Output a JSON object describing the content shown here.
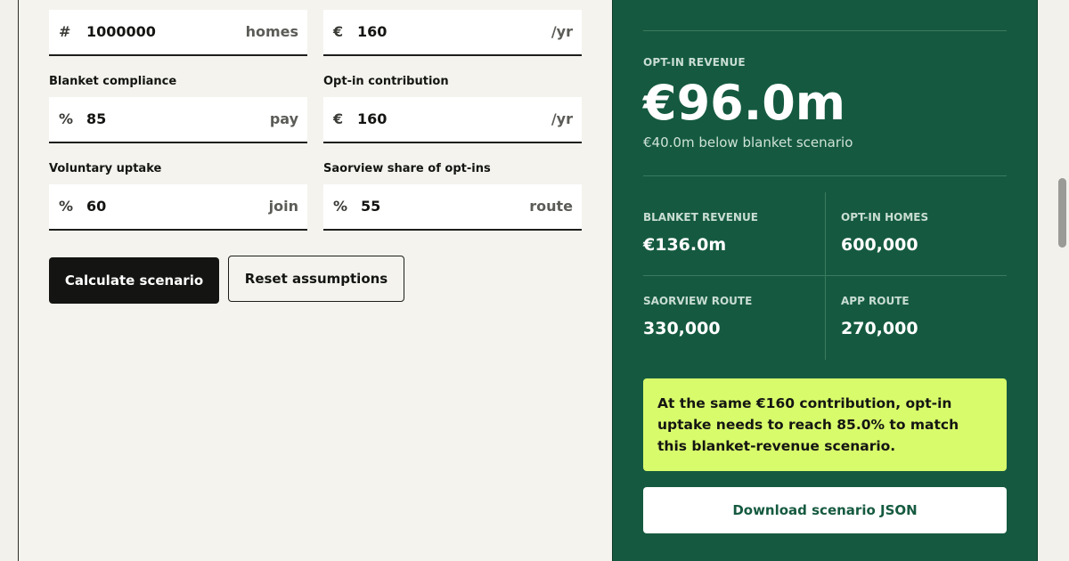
{
  "inputs": {
    "homes": {
      "label": "",
      "prefix": "#",
      "value": "1000000",
      "suffix": "homes"
    },
    "blanket_fee": {
      "label": "",
      "prefix": "€",
      "value": "160",
      "suffix": "/yr"
    },
    "blanket_compliance": {
      "label": "Blanket compliance",
      "prefix": "%",
      "value": "85",
      "suffix": "pay"
    },
    "optin_contribution": {
      "label": "Opt-in contribution",
      "prefix": "€",
      "value": "160",
      "suffix": "/yr"
    },
    "voluntary_uptake": {
      "label": "Voluntary uptake",
      "prefix": "%",
      "value": "60",
      "suffix": "join"
    },
    "saorview_share": {
      "label": "Saorview share of opt-ins",
      "prefix": "%",
      "value": "55",
      "suffix": "route"
    }
  },
  "actions": {
    "calculate_label": "Calculate scenario",
    "reset_label": "Reset assumptions",
    "download_label": "Download scenario JSON"
  },
  "results": {
    "optin_revenue_label": "Opt-in revenue",
    "optin_revenue_value": "€96.0m",
    "optin_revenue_delta": "€40.0m below blanket scenario",
    "stats": [
      {
        "label": "Blanket revenue",
        "value": "€136.0m"
      },
      {
        "label": "Opt-in homes",
        "value": "600,000"
      },
      {
        "label": "Saorview route",
        "value": "330,000"
      },
      {
        "label": "App route",
        "value": "270,000"
      }
    ],
    "callout": "At the same €160 contribution, opt-in uptake needs to reach 85.0% to match this blanket-revenue scenario."
  },
  "colors": {
    "panel_green": "#155a40",
    "callout_lime": "#d8fb6b",
    "primary_dark": "#141512"
  }
}
